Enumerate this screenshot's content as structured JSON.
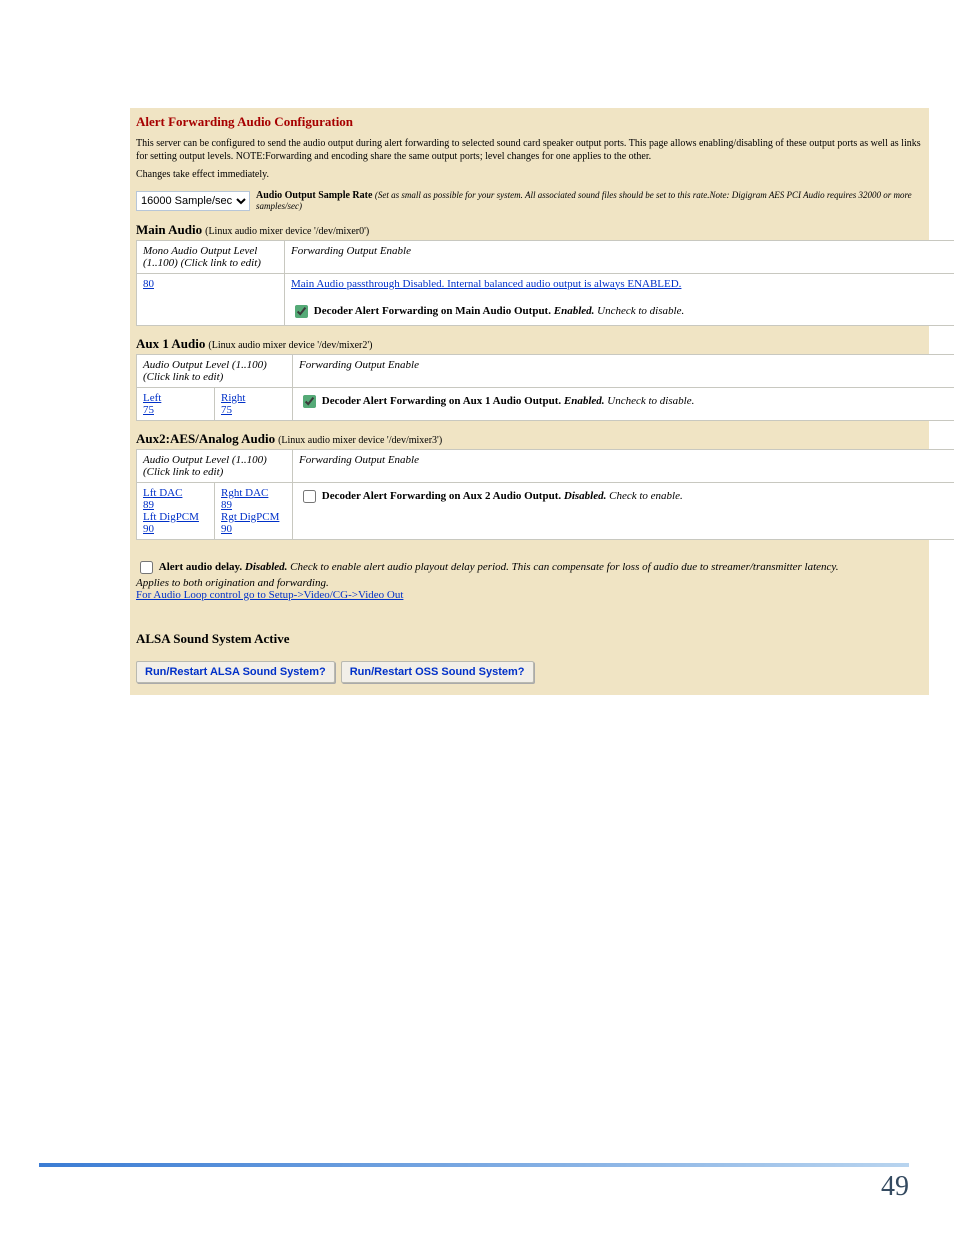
{
  "header": "Alert Forwarding Audio Configuration",
  "intro_lines": [
    "This server can be configured to send the audio output during alert forwarding to selected sound card speaker output ports. This page allows enabling/disabling of these output ports as well as links for setting output levels. NOTE:Forwarding and encoding share the same output ports; level changes for one applies to the other.",
    "Changes take effect immediately."
  ],
  "sample_rate": {
    "value": "16000 Sample/sec",
    "label": "Audio Output Sample Rate",
    "hint": "(Set as small as possible for your system. All associated sound files should be set to this rate.Note: Digigram AES PCI Audio requires 32000 or more samples/sec)"
  },
  "main": {
    "title": "Main Audio",
    "device": "(Linux audio mixer device '/dev/mixer0')",
    "col1": "Mono Audio Output Level (1..100) (Click link to edit)",
    "col2": "Forwarding Output Enable",
    "level": "80",
    "link": "Main Audio passthrough Disabled. Internal balanced audio output is always ENABLED.",
    "cb_label_pre": "Decoder Alert Forwarding on Main Audio Output. ",
    "cb_state": "Enabled.",
    "cb_tail": " Uncheck to disable."
  },
  "aux1": {
    "title": "Aux 1 Audio",
    "device": "(Linux audio mixer device '/dev/mixer2')",
    "col1": "Audio Output Level (1..100) (Click link to edit)",
    "col2": "Forwarding Output Enable",
    "left_label": "Left",
    "left_val": "75",
    "right_label": "Right",
    "right_val": "75",
    "cb_label_pre": "Decoder Alert Forwarding on Aux 1 Audio Output. ",
    "cb_state": "Enabled.",
    "cb_tail": " Uncheck to disable."
  },
  "aux2": {
    "title": "Aux2:AES/Analog Audio",
    "device": "(Linux audio mixer device '/dev/mixer3')",
    "col1": "Audio Output Level (1..100) (Click link to edit)",
    "col2": "Forwarding Output Enable",
    "c1": {
      "l1": "Lft DAC",
      "v1": "89",
      "l2": "Lft DigPCM",
      "v2": "90"
    },
    "c2": {
      "l1": "Rght DAC",
      "v1": "89",
      "l2": "Rgt DigPCM",
      "v2": "90"
    },
    "cb_label_pre": "Decoder Alert Forwarding on Aux 2 Audio Output. ",
    "cb_state": "Disabled.",
    "cb_tail": " Check to enable."
  },
  "delay": {
    "pre": "Alert audio delay. ",
    "state": "Disabled.",
    "tail": " Check to enable alert audio playout delay period. This can compensate for loss of audio due to streamer/transmitter latency.",
    "applies": "Applies to both origination and forwarding.",
    "link": "For Audio Loop control go to Setup->Video/CG->Video Out"
  },
  "alsa": "ALSA Sound System Active",
  "buttons": {
    "b1": "Run/Restart ALSA Sound System?",
    "b2": "Run/Restart OSS Sound System?"
  },
  "page_number": "49"
}
